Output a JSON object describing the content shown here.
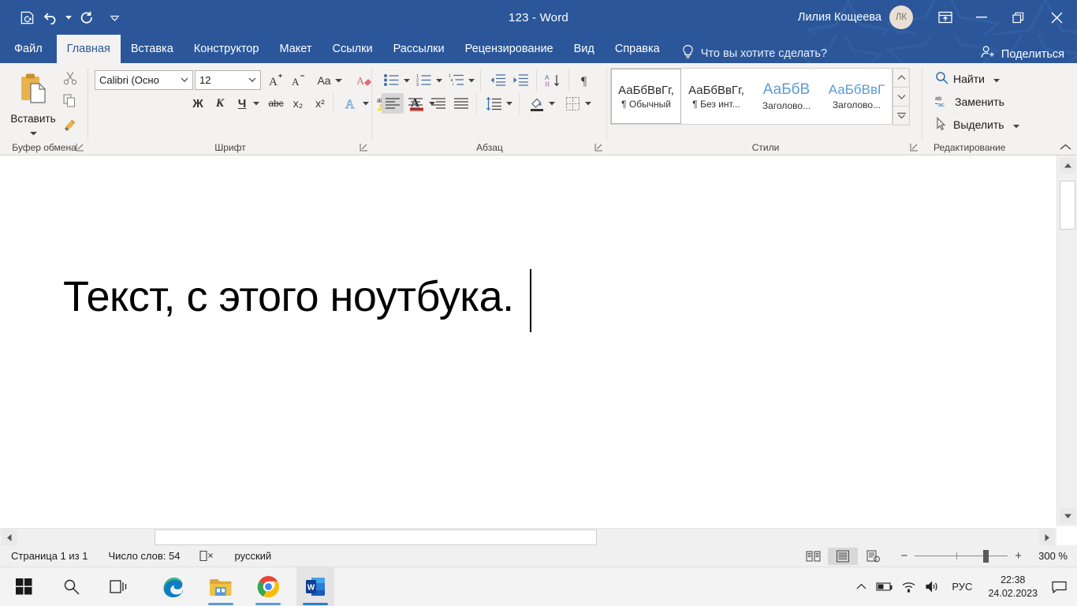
{
  "window": {
    "title": "123  -  Word",
    "user_name": "Лилия Кощеева",
    "avatar_initials": "ЛК",
    "accent_color": "#2b579a",
    "quick_access": [
      {
        "name": "save-icon",
        "tooltip": "Сохранить"
      },
      {
        "name": "undo-icon",
        "tooltip": "Отменить"
      },
      {
        "name": "redo-icon",
        "tooltip": "Вернуть"
      },
      {
        "name": "customize-qat-icon",
        "tooltip": "Настройка панели быстрого доступа"
      }
    ],
    "controls": [
      {
        "name": "ribbon-display-options-icon"
      },
      {
        "name": "minimize-icon"
      },
      {
        "name": "restore-icon"
      },
      {
        "name": "close-icon"
      }
    ]
  },
  "tabs": [
    {
      "label": "Файл",
      "active": false
    },
    {
      "label": "Главная",
      "active": true
    },
    {
      "label": "Вставка",
      "active": false
    },
    {
      "label": "Конструктор",
      "active": false
    },
    {
      "label": "Макет",
      "active": false
    },
    {
      "label": "Ссылки",
      "active": false
    },
    {
      "label": "Рассылки",
      "active": false
    },
    {
      "label": "Рецензирование",
      "active": false
    },
    {
      "label": "Вид",
      "active": false
    },
    {
      "label": "Справка",
      "active": false
    }
  ],
  "tell_me": {
    "placeholder": "Что вы хотите сделать?",
    "icon": "lightbulb-icon"
  },
  "share": {
    "label": "Поделиться",
    "icon": "person-add-icon"
  },
  "ribbon": {
    "clipboard": {
      "label": "Буфер обмена",
      "paste_label": "Вставить",
      "buttons": [
        {
          "name": "cut-icon",
          "label": "Вырезать"
        },
        {
          "name": "copy-icon",
          "label": "Копировать"
        },
        {
          "name": "format-painter-icon",
          "label": "Формат по образцу"
        }
      ]
    },
    "font": {
      "label": "Шрифт",
      "font_family_value": "Calibri (Осно",
      "font_size_value": "12",
      "buttons": [
        {
          "name": "grow-font-icon",
          "label": "A"
        },
        {
          "name": "shrink-font-icon",
          "label": "A"
        },
        {
          "name": "change-case-icon",
          "label": "Aa"
        },
        {
          "name": "clear-formatting-icon",
          "label": "Очистить форматирование"
        },
        {
          "name": "bold-icon",
          "label": "Ж"
        },
        {
          "name": "italic-icon",
          "label": "К"
        },
        {
          "name": "underline-icon",
          "label": "Ч"
        },
        {
          "name": "strikethrough-icon",
          "label": "abc"
        },
        {
          "name": "subscript-icon",
          "label": "x₂"
        },
        {
          "name": "superscript-icon",
          "label": "x²"
        },
        {
          "name": "text-effects-icon",
          "label": "A"
        },
        {
          "name": "highlight-color-icon",
          "label": "ab"
        },
        {
          "name": "font-color-icon",
          "label": "A"
        }
      ]
    },
    "paragraph": {
      "label": "Абзац",
      "buttons": [
        {
          "name": "bullets-icon"
        },
        {
          "name": "numbering-icon"
        },
        {
          "name": "multilevel-list-icon"
        },
        {
          "name": "decrease-indent-icon"
        },
        {
          "name": "increase-indent-icon"
        },
        {
          "name": "sort-icon"
        },
        {
          "name": "show-formatting-marks-icon"
        },
        {
          "name": "align-left-icon",
          "selected": true
        },
        {
          "name": "align-center-icon"
        },
        {
          "name": "align-right-icon"
        },
        {
          "name": "justify-icon"
        },
        {
          "name": "line-spacing-icon"
        },
        {
          "name": "shading-icon"
        },
        {
          "name": "borders-icon"
        }
      ]
    },
    "styles": {
      "label": "Стили",
      "items": [
        {
          "preview": "АаБбВвГг,",
          "name": "Обычный",
          "marker": "¶",
          "selected": true,
          "kind": "normal"
        },
        {
          "preview": "АаБбВвГг,",
          "name": "Без инт...",
          "marker": "¶",
          "selected": false,
          "kind": "normal"
        },
        {
          "preview": "АаБбВ",
          "name": "Заголово...",
          "marker": "",
          "selected": false,
          "kind": "h1"
        },
        {
          "preview": "АаБбВвГ",
          "name": "Заголово...",
          "marker": "",
          "selected": false,
          "kind": "h2"
        }
      ]
    },
    "editing": {
      "label": "Редактирование",
      "items": [
        {
          "label": "Найти",
          "icon": "search-icon",
          "has_caret": true
        },
        {
          "label": "Заменить",
          "icon": "replace-icon",
          "has_caret": false
        },
        {
          "label": "Выделить",
          "icon": "select-icon",
          "has_caret": true
        }
      ]
    }
  },
  "document": {
    "text": "Текст, с этого ноутбука.",
    "caret_visible": true
  },
  "status_bar": {
    "page": "Страница 1 из 1",
    "word_count": "Число слов: 54",
    "proofing_icon": "proofing-errors-icon",
    "language": "русский",
    "views": [
      {
        "name": "read-mode-icon",
        "selected": false
      },
      {
        "name": "print-layout-icon",
        "selected": true
      },
      {
        "name": "web-layout-icon",
        "selected": false
      }
    ],
    "zoom_out": "−",
    "zoom_in": "+",
    "zoom_level": "300 %"
  },
  "taskbar": {
    "items": [
      {
        "name": "start-icon",
        "label": "Пуск"
      },
      {
        "name": "search-icon",
        "label": "Поиск"
      },
      {
        "name": "task-view-icon",
        "label": "Представление задач"
      },
      {
        "name": "edge-icon",
        "label": "Microsoft Edge"
      },
      {
        "name": "file-explorer-icon",
        "label": "Проводник"
      },
      {
        "name": "chrome-icon",
        "label": "Google Chrome"
      },
      {
        "name": "word-icon",
        "label": "Word",
        "active": true
      }
    ],
    "tray": {
      "chevron": "show-hidden-icons-icon",
      "battery": "battery-icon",
      "network": "wifi-icon",
      "volume": "volume-icon",
      "language": "РУС",
      "time": "22:38",
      "date": "24.02.2023",
      "notifications": "notification-center-icon"
    }
  }
}
